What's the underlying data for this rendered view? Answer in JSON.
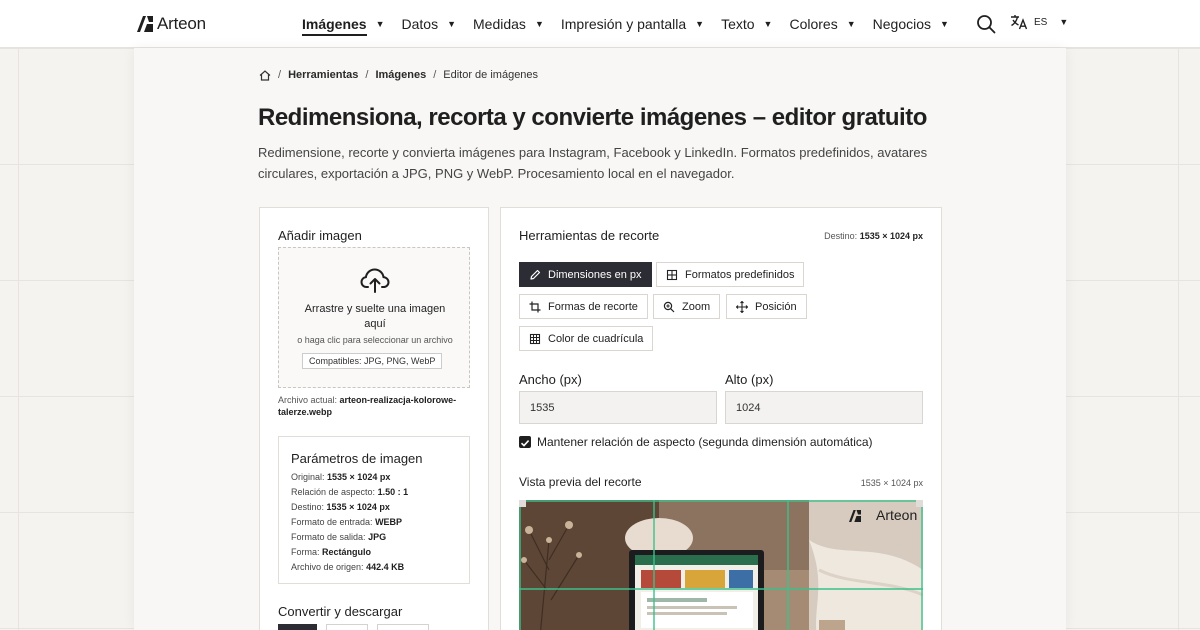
{
  "brand": {
    "name": "Arteon"
  },
  "nav": {
    "items": [
      {
        "label": "Imágenes",
        "active": true
      },
      {
        "label": "Datos"
      },
      {
        "label": "Medidas"
      },
      {
        "label": "Impresión y pantalla"
      },
      {
        "label": "Texto"
      },
      {
        "label": "Colores"
      },
      {
        "label": "Negocios"
      }
    ],
    "language": "ES",
    "icons": {
      "search": "search-icon",
      "translate": "translate-icon",
      "home": "home-icon"
    }
  },
  "breadcrumb": {
    "items": [
      "Herramientas",
      "Imágenes",
      "Editor de imágenes"
    ]
  },
  "page": {
    "title": "Redimensiona, recorta y convierte imágenes – editor gratuito",
    "description": "Redimensione, recorte y convierta imágenes para Instagram, Facebook y LinkedIn. Formatos predefinidos, avatares circulares, exportación a JPG, PNG y WebP. Procesamiento local en el navegador."
  },
  "upload": {
    "title": "Añadir imagen",
    "drop_main": "Arrastre y suelte una imagen aquí",
    "drop_sub": "o haga clic para seleccionar un archivo",
    "supported": "Compatibles: JPG, PNG, WebP",
    "current_label": "Archivo actual:",
    "current_file": "arteon-realizacja-kolorowe-talerze.webp"
  },
  "params": {
    "title": "Parámetros de imagen",
    "rows": [
      {
        "label": "Original:",
        "value": "1535 × 1024 px"
      },
      {
        "label": "Relación de aspecto:",
        "value": "1.50 : 1"
      },
      {
        "label": "Destino:",
        "value": "1535 × 1024 px"
      },
      {
        "label": "Formato de entrada:",
        "value": "WEBP"
      },
      {
        "label": "Formato de salida:",
        "value": "JPG"
      },
      {
        "label": "Forma:",
        "value": "Rectángulo"
      },
      {
        "label": "Archivo de origen:",
        "value": "442.4 KB"
      }
    ]
  },
  "convert": {
    "title": "Convertir y descargar"
  },
  "crop": {
    "title": "Herramientas de recorte",
    "dest_label": "Destino:",
    "dest_value": "1535 × 1024 px",
    "tools": [
      {
        "label": "Dimensiones en px",
        "icon": "pencil-icon",
        "active": true
      },
      {
        "label": "Formatos predefinidos",
        "icon": "grid-icon"
      },
      {
        "label": "Formas de recorte",
        "icon": "crop-icon"
      },
      {
        "label": "Zoom",
        "icon": "zoom-icon"
      },
      {
        "label": "Posición",
        "icon": "move-icon"
      },
      {
        "label": "Color de cuadrícula",
        "icon": "grid-icon"
      }
    ],
    "width_label": "Ancho (px)",
    "width_value": "1535",
    "height_label": "Alto (px)",
    "height_value": "1024",
    "keep_ratio_label": "Mantener relación de aspecto (segunda dimensión automática)",
    "keep_ratio_checked": true,
    "preview_title": "Vista previa del recorte",
    "preview_size": "1535 × 1024 px",
    "grid_color": "#3cc08a"
  }
}
